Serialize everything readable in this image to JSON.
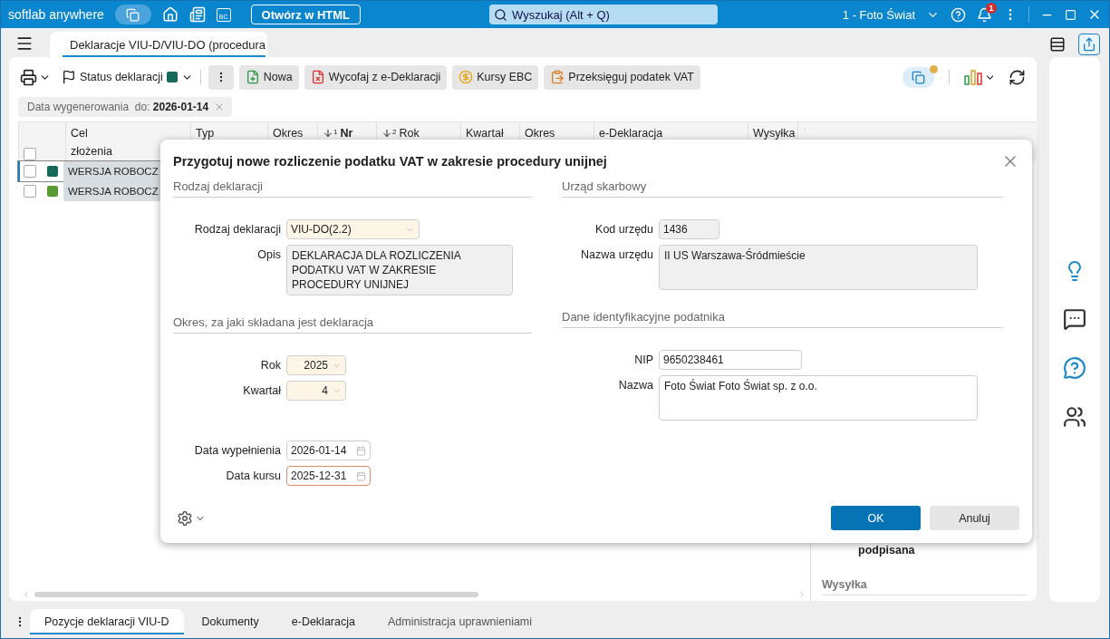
{
  "app_bar": {
    "brand": "softlab anywhere",
    "bc_icon_text": "BC",
    "open_html_button": "Otwórz w HTML",
    "search": {
      "placeholder": "Wyszukaj (Alt + Q)"
    },
    "company": "1 - Foto Świat",
    "notification_count": "1"
  },
  "document_tabs": [
    {
      "label": "Deklaracje VIU-D/VIU-DO (procedura",
      "selected": true
    }
  ],
  "toolbar": {
    "status": {
      "label": "Status deklaracji",
      "color": "#17695a"
    },
    "buttons": [
      {
        "label": "Nowa"
      },
      {
        "label": "Wycofaj z e-Deklaracji"
      },
      {
        "label": "Kursy EBC"
      },
      {
        "label": "Przeksięguj podatek VAT"
      }
    ]
  },
  "filter": {
    "label": "Data wygenerowania",
    "operator": "do:",
    "value": "2026-01-14"
  },
  "table": {
    "select_all": {
      "checked": false
    },
    "columns": [
      {
        "label": "Cel złożenia"
      },
      {
        "label": "Typ"
      },
      {
        "label": "Okres"
      },
      {
        "label": "Nr",
        "sort_order": "1"
      },
      {
        "label": "Rok",
        "sort_order": "2"
      },
      {
        "label": "Kwartał"
      },
      {
        "label": "Okres"
      },
      {
        "label": "e-Deklaracja"
      },
      {
        "label": "Wysyłka"
      }
    ],
    "rows": [
      {
        "selected": true,
        "checked": false,
        "color": "#17695a",
        "purpose": "WERSJA ROBOCZ"
      },
      {
        "selected": false,
        "checked": false,
        "color": "#5a9a35",
        "purpose": "WERSJA ROBOCZ"
      }
    ]
  },
  "side_panel": {
    "status_text": "podpisana",
    "section": "Wysyłka"
  },
  "bottom_tabs": [
    {
      "label": "Pozycje deklaracji VIU-D",
      "selected": true
    },
    {
      "label": "Dokumenty",
      "selected": false
    },
    {
      "label": "e-Deklaracja",
      "selected": false
    },
    {
      "label": "Administracja uprawnieniami",
      "selected": false
    }
  ],
  "dialog": {
    "title": "Przygotuj nowe rozliczenie podatku VAT w zakresie procedury unijnej",
    "columns": [
      [
        {
          "title": "Rodzaj deklaracji",
          "fields": [
            {
              "label": "Rodzaj deklaracji",
              "kind": "select",
              "value": "VIU-DO(2.2)",
              "readonly": false,
              "invalid": false
            },
            {
              "label": "Opis",
              "kind": "memo",
              "value": "DEKLARACJA DLA ROZLICZENIA PODATKU VAT W ZAKRESIE PROCEDURY UNIJNEJ",
              "readonly": true,
              "invalid": false
            }
          ]
        },
        {
          "title": "Okres, za jaki składana jest deklaracja",
          "fields": [
            {
              "label": "Rok",
              "kind": "number-select",
              "value": "2025",
              "readonly": false,
              "invalid": false
            },
            {
              "label": "Kwartał",
              "kind": "number-select",
              "value": "4",
              "readonly": false,
              "invalid": false
            },
            {
              "label": "Data wypełnienia",
              "kind": "date",
              "value": "2026-01-14",
              "readonly": false,
              "invalid": false
            },
            {
              "label": "Data kursu",
              "kind": "date",
              "value": "2025-12-31",
              "readonly": false,
              "invalid": true
            }
          ]
        }
      ],
      [
        {
          "title": "Urząd skarbowy",
          "fields": [
            {
              "label": "Kod urzędu",
              "kind": "short-text",
              "value": "1436",
              "readonly": true,
              "invalid": false
            },
            {
              "label": "Nazwa urzędu",
              "kind": "memo",
              "value": "II US Warszawa-Śródmieście",
              "readonly": true,
              "invalid": false
            }
          ]
        },
        {
          "title": "Dane identyfikacyjne podatnika",
          "fields": [
            {
              "label": "NIP",
              "kind": "text",
              "value": "9650238461",
              "readonly": false,
              "invalid": false
            },
            {
              "label": "Nazwa",
              "kind": "memo",
              "value": "Foto Świat Foto Świat sp. z o.o.",
              "readonly": false,
              "invalid": false
            }
          ]
        }
      ]
    ],
    "buttons": [
      {
        "label": "OK",
        "kind": "primary"
      },
      {
        "label": "Anuluj",
        "kind": "secondary"
      }
    ]
  }
}
